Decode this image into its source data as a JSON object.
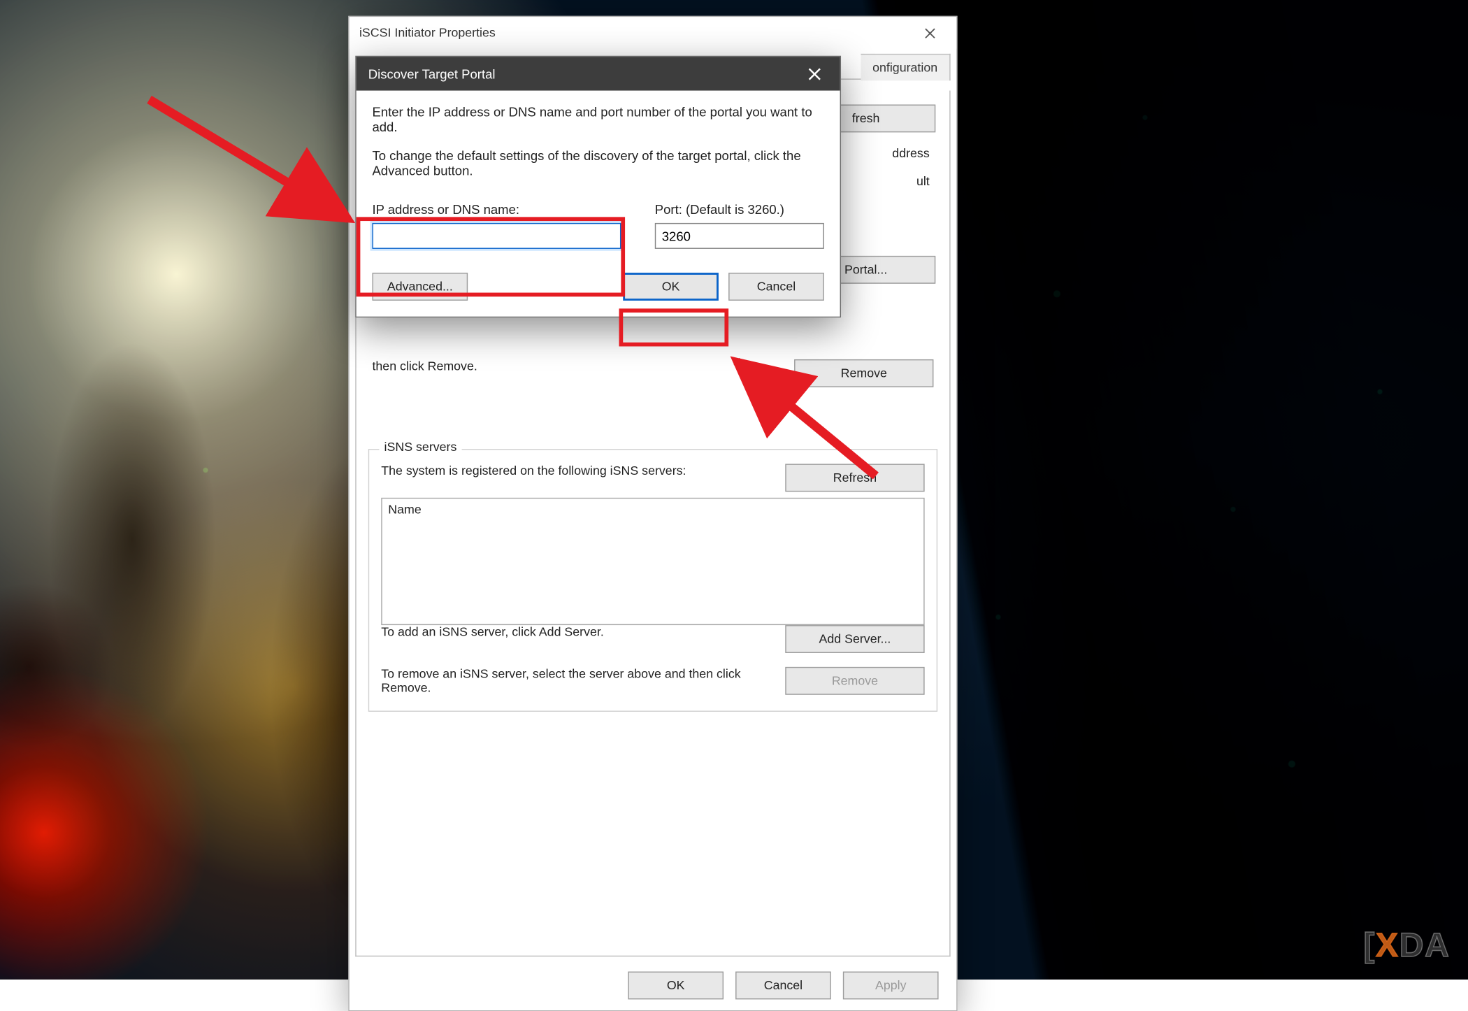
{
  "parentWindow": {
    "title": "iSCSI Initiator Properties",
    "tabs": {
      "configuration": "onfiguration"
    },
    "peek": {
      "refresh": "fresh",
      "ipAddress": "ddress",
      "default": "ult",
      "portal": "Portal..."
    },
    "targetPortals": {
      "removeHint": "To remove a target portal, select the address above and then click Remove.",
      "removeHintTrunc": "then click Remove.",
      "remove": "Remove"
    },
    "isns": {
      "legend": "iSNS servers",
      "hint": "The system is registered on the following iSNS servers:",
      "refresh": "Refresh",
      "nameHeader": "Name",
      "addHint": "To add an iSNS server, click Add Server.",
      "addServer": "Add Server...",
      "removeHint": "To remove an iSNS server, select the server above and then click Remove.",
      "remove": "Remove"
    },
    "footer": {
      "ok": "OK",
      "cancel": "Cancel",
      "apply": "Apply"
    }
  },
  "dialog": {
    "title": "Discover Target Portal",
    "p1": "Enter the IP address or DNS name and port number of the portal you want to add.",
    "p2": "To change the default settings of the discovery of the target portal, click the Advanced button.",
    "ipLabel": "IP address or DNS name:",
    "ipValue": "",
    "portLabel": "Port: (Default is 3260.)",
    "portValue": "3260",
    "advanced": "Advanced...",
    "ok": "OK",
    "cancel": "Cancel"
  },
  "watermark": {
    "x": "X",
    "da": "DA"
  },
  "annotations": {
    "color_highlight": "#e51c23",
    "color_arrow": "#e51c23"
  }
}
